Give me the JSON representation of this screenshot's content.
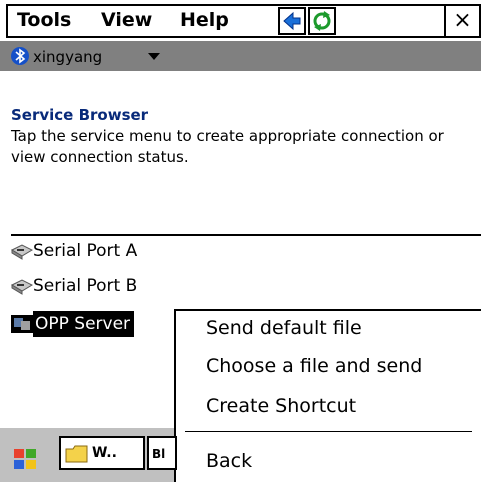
{
  "menubar": {
    "items": [
      "Tools",
      "View",
      "Help"
    ],
    "close_label": "×"
  },
  "device": {
    "name": "xingyang",
    "icon": "bluetooth-icon"
  },
  "header": {
    "title": "Service Browser",
    "description": "Tap the service menu to create appropriate connection or view connection status."
  },
  "services": [
    {
      "label": "Serial Port A",
      "icon": "serial-port-icon"
    },
    {
      "label": "Serial Port B",
      "icon": "serial-port-icon"
    },
    {
      "label": "OPP Server",
      "icon": "opp-server-icon",
      "selected": true
    }
  ],
  "context_menu": {
    "items": [
      "Send default file",
      "Choose a file and send",
      "Create Shortcut",
      "Back"
    ]
  },
  "taskbar": {
    "task1": "W..",
    "task2": "Bl"
  },
  "colors": {
    "bar_gray": "#808080",
    "title_blue": "#082a7a",
    "bluetooth_blue": "#1550c8",
    "selection": "#000000"
  }
}
